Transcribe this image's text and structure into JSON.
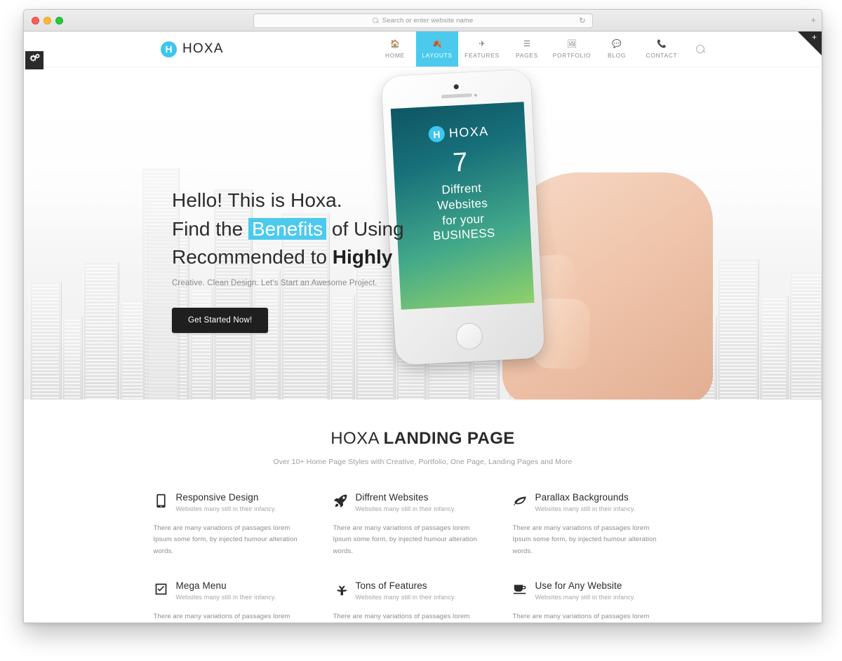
{
  "browser": {
    "address_placeholder": "Search or enter website name",
    "reload_icon": "reload-icon",
    "new_tab_label": "+",
    "traffic_lights": [
      "close",
      "minimize",
      "zoom"
    ]
  },
  "theme": {
    "accent": "#4ccaee",
    "dark": "#1f1f1f",
    "muted_text": "#8d8d8d"
  },
  "widgets": {
    "settings_tab_icon": "gears-icon",
    "corner_ribbon_label": "+"
  },
  "header": {
    "brand_mark": "H",
    "brand_name": "HOXA",
    "nav": [
      {
        "label": "HOME",
        "icon": "home-icon",
        "active": false
      },
      {
        "label": "LAYOUTS",
        "icon": "leaf-icon",
        "active": true
      },
      {
        "label": "FEATURES",
        "icon": "paper-plane-icon",
        "active": false
      },
      {
        "label": "PAGES",
        "icon": "pages-icon",
        "active": false
      },
      {
        "label": "PORTFOLIO",
        "icon": "image-icon",
        "active": false
      },
      {
        "label": "BLOG",
        "icon": "comment-icon",
        "active": false
      },
      {
        "label": "CONTACT",
        "icon": "phone-icon",
        "active": false
      }
    ],
    "search_icon": "search-icon"
  },
  "hero": {
    "line1": "Hello! This is Hoxa.",
    "line2_pre": "Find the ",
    "line2_highlight": "Benefits",
    "line2_post": " of Using",
    "line3_pre": "Recommended to ",
    "line3_strong": "Highly",
    "subtitle": "Creative. Clean Design. Let's Start an Awesome Project.",
    "cta_label": "Get Started Now!",
    "phone": {
      "brand_mark": "H",
      "brand_name": "HOXA",
      "number": "7",
      "line1": "Diffrent",
      "line2": "Websites",
      "line3": "for your",
      "line4": "BUSINESS"
    }
  },
  "landing": {
    "title_light": "HOXA ",
    "title_bold": "LANDING PAGE",
    "subtitle": "Over 10+ Home Page Styles with Creative, Portfolio, One Page, Landing Pages and More",
    "features": [
      {
        "icon": "tablet-icon",
        "title": "Responsive Design",
        "tagline": "Websites many still in their infancy.",
        "body": "There are many variations of passages lorem Ipsum some form, by injected humour alteration words."
      },
      {
        "icon": "rocket-icon",
        "title": "Diffrent Websites",
        "tagline": "Websites many still in their infancy.",
        "body": "There are many variations of passages lorem Ipsum some form, by injected humour alteration words."
      },
      {
        "icon": "leaf-icon",
        "title": "Parallax Backgrounds",
        "tagline": "Websites many still in their infancy.",
        "body": "There are many variations of passages lorem Ipsum some form, by injected humour alteration words."
      },
      {
        "icon": "check-square-icon",
        "title": "Mega Menu",
        "tagline": "Websites many still in their infancy.",
        "body": "There are many variations of passages lorem Ipsum some form, by injected humour alteration words."
      },
      {
        "icon": "plant-icon",
        "title": "Tons of Features",
        "tagline": "Websites many still in their infancy.",
        "body": "There are many variations of passages lorem Ipsum some form, by injected humour alteration words."
      },
      {
        "icon": "coffee-cup-icon",
        "title": "Use for Any Website",
        "tagline": "Websites many still in their infancy.",
        "body": "There are many variations of passages lorem Ipsum some form, by injected humour alteration words."
      }
    ]
  }
}
